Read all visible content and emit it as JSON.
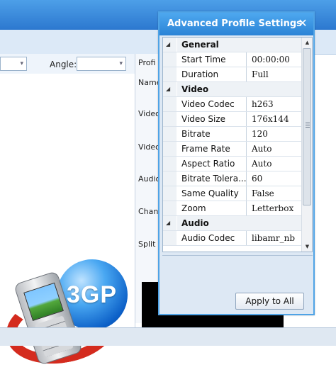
{
  "background": {
    "angle_label": "Angle:",
    "side_labels": [
      "Profi",
      "Name",
      "Video",
      "Video",
      "Audio",
      "Chan",
      "Split"
    ]
  },
  "logo": {
    "text": "3GP"
  },
  "panel": {
    "title": "Advanced Profile Settings",
    "close_icon": "close-icon",
    "categories": [
      {
        "name": "General",
        "props": [
          {
            "name": "Start Time",
            "value": "00:00:00"
          },
          {
            "name": "Duration",
            "value": "Full"
          }
        ]
      },
      {
        "name": "Video",
        "props": [
          {
            "name": "Video Codec",
            "value": "h263"
          },
          {
            "name": "Video Size",
            "value": "176x144"
          },
          {
            "name": "Bitrate",
            "value": "120"
          },
          {
            "name": "Frame Rate",
            "value": "Auto"
          },
          {
            "name": "Aspect Ratio",
            "value": "Auto"
          },
          {
            "name": "Bitrate Tolera...",
            "value": "60"
          },
          {
            "name": "Same Quality",
            "value": "False"
          },
          {
            "name": "Zoom",
            "value": "Letterbox"
          }
        ]
      },
      {
        "name": "Audio",
        "props": [
          {
            "name": "Audio Codec",
            "value": "libamr_nb"
          }
        ]
      }
    ],
    "apply_label": "Apply to All"
  },
  "colors": {
    "title_bar": "#2a83d6",
    "panel_border": "#4fa3e6",
    "panel_bg": "#dde8f4"
  }
}
